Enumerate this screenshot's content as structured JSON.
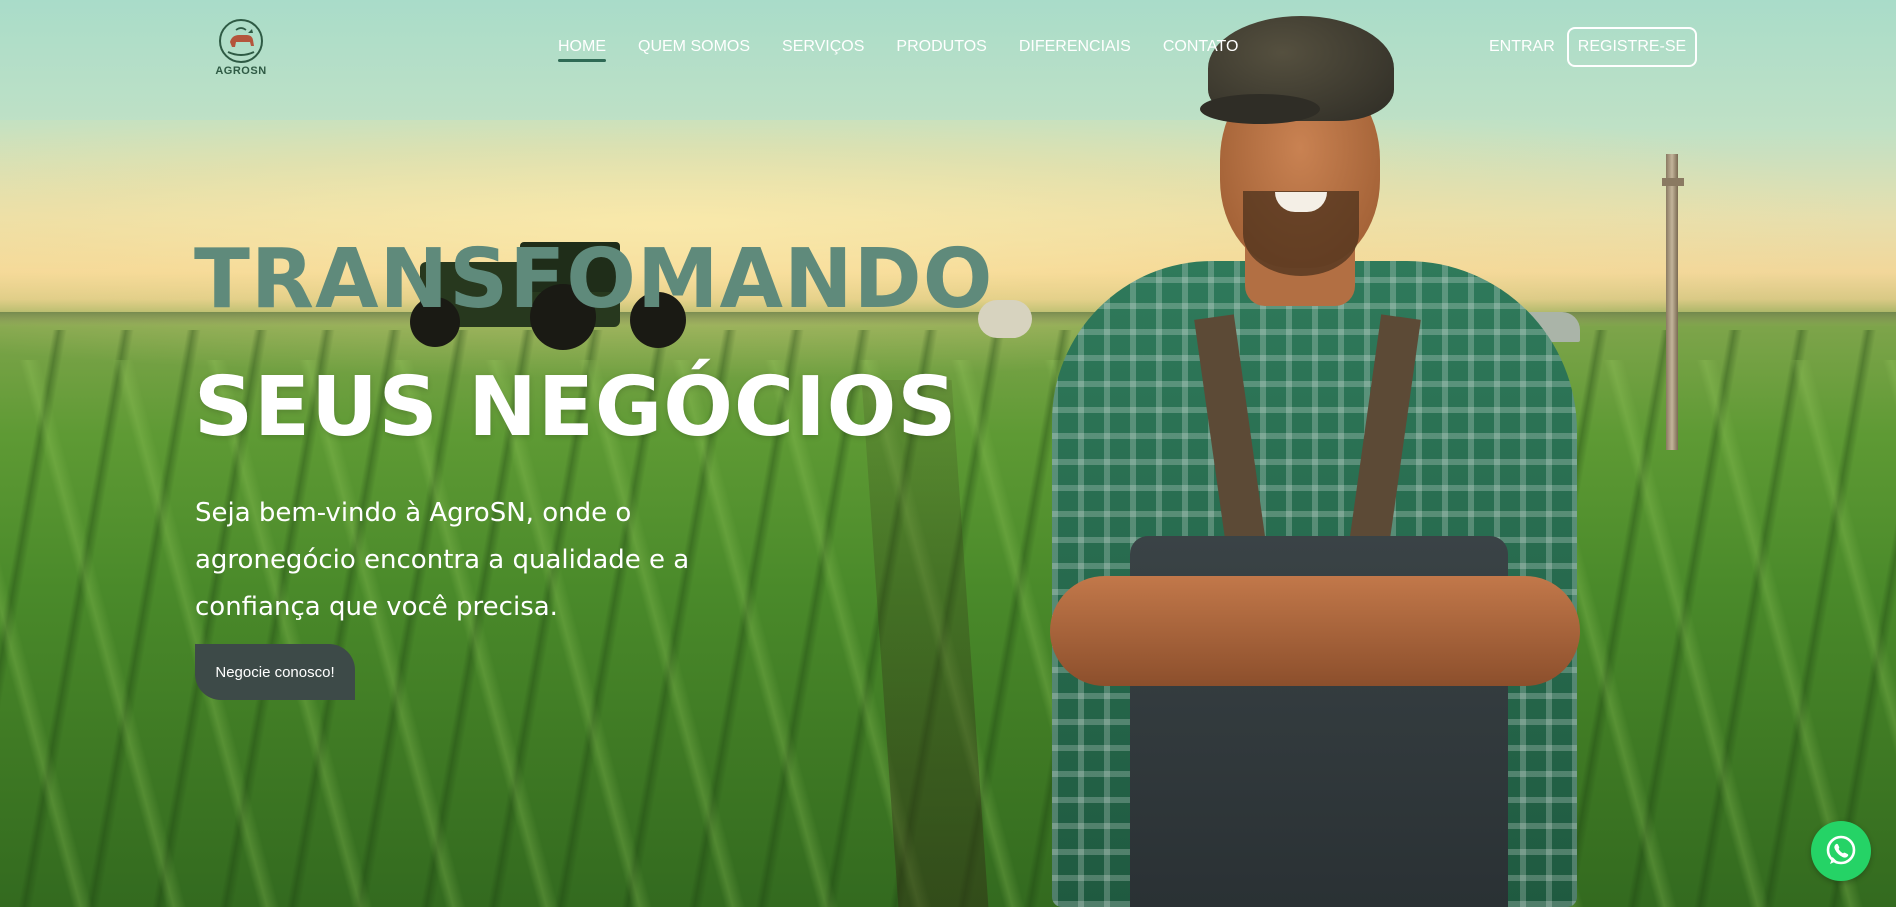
{
  "brand": {
    "logo_text": "AGROSN"
  },
  "nav": {
    "items": [
      {
        "label": "HOME",
        "active": true
      },
      {
        "label": "QUEM SOMOS",
        "active": false
      },
      {
        "label": "SERVIÇOS",
        "active": false
      },
      {
        "label": "PRODUTOS",
        "active": false
      },
      {
        "label": "DIFERENCIAIS",
        "active": false
      },
      {
        "label": "CONTATO",
        "active": false
      }
    ],
    "login_label": "ENTRAR",
    "register_label": "REGISTRE-SE"
  },
  "hero": {
    "headline_line1": "TRANSFOMANDO",
    "headline_line2": "SEUS NEGÓCIOS",
    "tagline": "Seja bem-vindo à AgroSN, onde o agronegócio encontra a qualidade e a confiança que você precisa.",
    "cta_label": "Negocie conosco!"
  },
  "colors": {
    "accent": "#2f6a55",
    "headline_green": "#5f8a7b",
    "cta_background": "#3d4a48",
    "whatsapp": "#25d366"
  },
  "floating": {
    "icon": "whatsapp-icon"
  }
}
